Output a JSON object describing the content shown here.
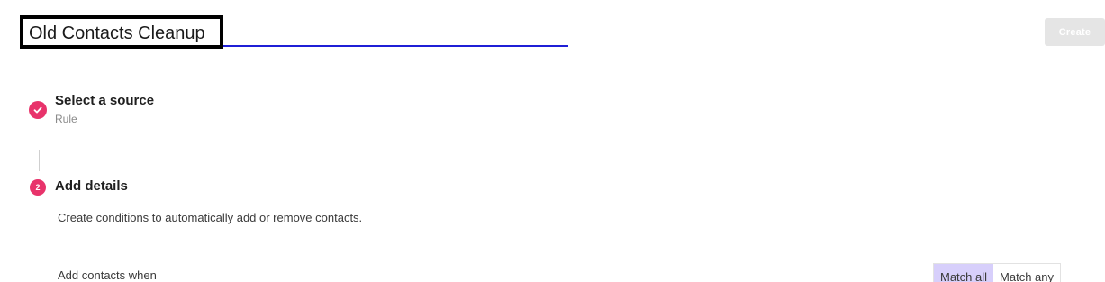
{
  "header": {
    "title_value": "Old Contacts Cleanup",
    "create_label": "Create"
  },
  "steps": [
    {
      "title": "Select a source",
      "subtitle": "Rule",
      "status": "completed"
    },
    {
      "number": "2",
      "title": "Add details",
      "description": "Create conditions to automatically add or remove contacts.",
      "status": "active"
    }
  ],
  "conditions": {
    "label": "Add contacts when",
    "match_options": [
      {
        "label": "Match all",
        "selected": true
      },
      {
        "label": "Match any",
        "selected": false
      }
    ]
  },
  "colors": {
    "accent": "#e8336b",
    "underline": "#1f1fd6",
    "toggle_selected": "#d7cffb",
    "button_disabled": "#e5e5e5"
  },
  "icons": {
    "step1": "checkmark-icon"
  }
}
